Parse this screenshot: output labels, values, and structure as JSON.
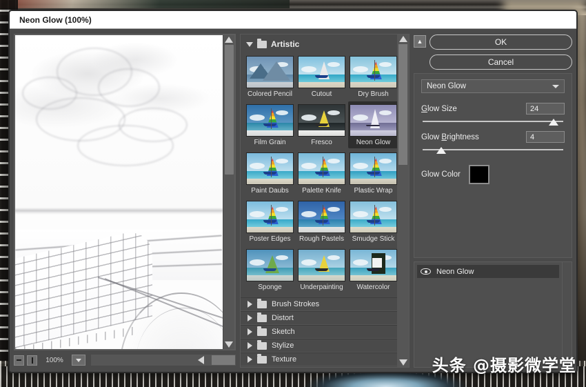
{
  "window": {
    "title": "Neon Glow (100%)"
  },
  "preview": {
    "zoom_level": "100%",
    "zoom_out_icon": "minus-icon",
    "zoom_in_icon": "plus-icon",
    "zoom_dropdown_icon": "chevron-down-icon",
    "scroll_up_icon": "triangle-up-icon",
    "scroll_down_icon": "triangle-down-icon",
    "scroll_left_icon": "triangle-left-icon",
    "scroll_right_icon": "triangle-right-icon"
  },
  "gallery": {
    "expanded_category": {
      "label": "Artistic",
      "twisty_icon": "triangle-down-icon",
      "folder_icon": "folder-icon",
      "filters": [
        {
          "label": "Colored Pencil",
          "selected": false,
          "style": "pencil"
        },
        {
          "label": "Cutout",
          "selected": false,
          "style": "cutout"
        },
        {
          "label": "Dry Brush",
          "selected": false,
          "style": "drybrush"
        },
        {
          "label": "Film Grain",
          "selected": false,
          "style": "filmgrain"
        },
        {
          "label": "Fresco",
          "selected": false,
          "style": "fresco"
        },
        {
          "label": "Neon Glow",
          "selected": true,
          "style": "neonglow"
        },
        {
          "label": "Paint Daubs",
          "selected": false,
          "style": "paintdaubs"
        },
        {
          "label": "Palette Knife",
          "selected": false,
          "style": "paletteknife"
        },
        {
          "label": "Plastic Wrap",
          "selected": false,
          "style": "plasticwrap"
        },
        {
          "label": "Poster Edges",
          "selected": false,
          "style": "posteredges"
        },
        {
          "label": "Rough Pastels",
          "selected": false,
          "style": "roughpastels"
        },
        {
          "label": "Smudge Stick",
          "selected": false,
          "style": "smudgestick"
        },
        {
          "label": "Sponge",
          "selected": false,
          "style": "sponge"
        },
        {
          "label": "Underpainting",
          "selected": false,
          "style": "underpainting"
        },
        {
          "label": "Watercolor",
          "selected": false,
          "style": "watercolor"
        }
      ]
    },
    "collapsed_categories": [
      {
        "label": "Brush Strokes",
        "twisty_icon": "triangle-right-icon",
        "folder_icon": "folder-icon"
      },
      {
        "label": "Distort",
        "twisty_icon": "triangle-right-icon",
        "folder_icon": "folder-icon"
      },
      {
        "label": "Sketch",
        "twisty_icon": "triangle-right-icon",
        "folder_icon": "folder-icon"
      },
      {
        "label": "Stylize",
        "twisty_icon": "triangle-right-icon",
        "folder_icon": "folder-icon"
      },
      {
        "label": "Texture",
        "twisty_icon": "triangle-right-icon",
        "folder_icon": "folder-icon"
      }
    ]
  },
  "settings": {
    "collapse_button_icon": "double-chevron-up-icon",
    "ok_label": "OK",
    "cancel_label": "Cancel",
    "filter_select": {
      "value": "Neon Glow",
      "chevron_icon": "chevron-down-icon"
    },
    "params": [
      {
        "label": "Glow Size",
        "mnemonic": "G",
        "value": "24",
        "slider_percent": 93
      },
      {
        "label": "Glow Brightness",
        "mnemonic": "B",
        "value": "4",
        "slider_percent": 13
      }
    ],
    "glow_color": {
      "label": "Glow Color",
      "color": "#000000"
    }
  },
  "layers": {
    "items": [
      {
        "name": "Neon Glow",
        "visible": true,
        "eye_icon": "eye-icon"
      }
    ]
  },
  "watermark": {
    "text": "头条 @摄影微学堂"
  },
  "colors": {
    "dialog_bg": "#4a4a4a",
    "panel_bg": "#4f4f4f",
    "selected_thumb_bg": "#2e2e2e",
    "title_bg": "#ffffff",
    "text": "#ececec"
  }
}
